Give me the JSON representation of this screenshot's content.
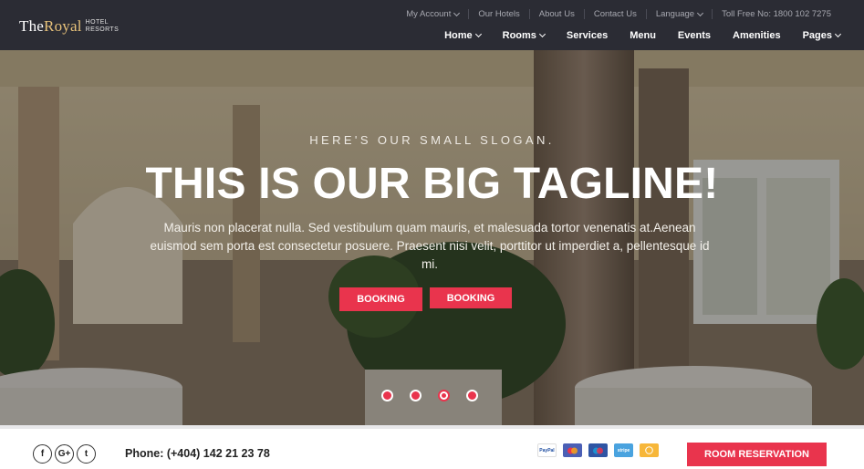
{
  "header": {
    "logo": {
      "the": "The",
      "royal": "Royal",
      "sub_line1": "HOTEL",
      "sub_line2": "RESORTS"
    },
    "top_links": [
      {
        "label": "My Account",
        "dropdown": true
      },
      {
        "label": "Our Hotels",
        "dropdown": false
      },
      {
        "label": "About Us",
        "dropdown": false
      },
      {
        "label": "Contact Us",
        "dropdown": false
      },
      {
        "label": "Language",
        "dropdown": true
      },
      {
        "label": "Toll Free No: 1800 102 7275",
        "dropdown": false
      }
    ],
    "nav": [
      {
        "label": "Home",
        "dropdown": true
      },
      {
        "label": "Rooms",
        "dropdown": true
      },
      {
        "label": "Services",
        "dropdown": false
      },
      {
        "label": "Menu",
        "dropdown": false
      },
      {
        "label": "Events",
        "dropdown": false
      },
      {
        "label": "Amenities",
        "dropdown": false
      },
      {
        "label": "Pages",
        "dropdown": true
      }
    ]
  },
  "hero": {
    "slogan": "HERE'S OUR SMALL SLOGAN.",
    "tagline": "THIS IS OUR BIG TAGLINE!",
    "text": "Mauris non placerat nulla. Sed vestibulum quam mauris, et malesuada tortor venenatis at.Aenean euismod sem porta est consectetur posuere. Praesent nisi velit, porttitor ut imperdiet a, pellentesque id mi.",
    "buttons": [
      "BOOKING",
      "BOOKING"
    ],
    "slides": 4,
    "active_slide": 3
  },
  "bottom_bar": {
    "socials": [
      {
        "icon": "facebook-icon",
        "glyph": "f"
      },
      {
        "icon": "google-plus-icon",
        "glyph": "G+"
      },
      {
        "icon": "twitter-icon",
        "glyph": "t"
      }
    ],
    "phone": "Phone: (+404) 142 21 23 78",
    "payments": [
      {
        "icon": "paypal-icon",
        "label": "PayPal",
        "color": "#ffffff"
      },
      {
        "icon": "mastercard-icon",
        "label": "",
        "color": "#4b5fb5"
      },
      {
        "icon": "maestro-icon",
        "label": "",
        "color": "#2f55a4"
      },
      {
        "icon": "stripe-icon",
        "label": "stripe",
        "color": "#4aa3df"
      },
      {
        "icon": "bitcoin-icon",
        "label": "",
        "color": "#f7b73a"
      }
    ],
    "reserve_label": "ROOM RESERVATION"
  },
  "colors": {
    "accent": "#e9344d",
    "header_bg": "#2b2c34",
    "logo_gold": "#e8c27a"
  }
}
